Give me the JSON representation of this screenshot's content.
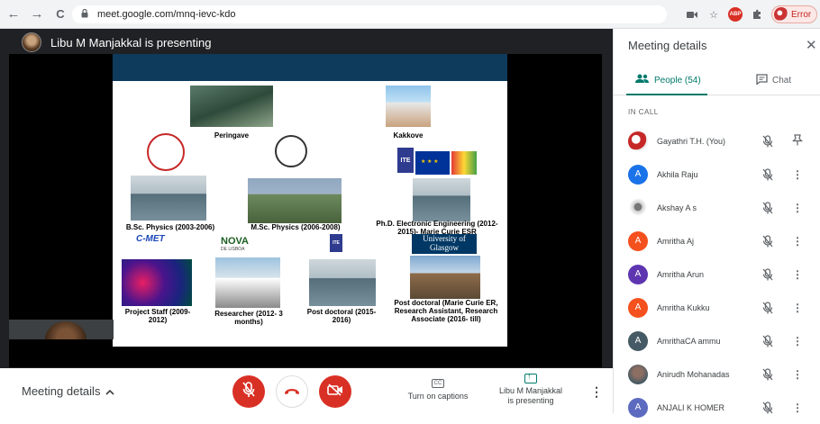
{
  "browser": {
    "back_icon": "←",
    "forward_icon": "→",
    "reload_icon": "C",
    "url": "meet.google.com/mnq-ievc-kdo",
    "profile_status": "Error"
  },
  "stage": {
    "presenter_text": "Libu M Manjakkal is presenting"
  },
  "slide": {
    "labels": {
      "peringave": "Peringave",
      "kakkove": "Kakkove",
      "bsc": "B.Sc. Physics (2003-2006)",
      "msc": "M.Sc. Physics (2006-2008)",
      "phd": "Ph.D. Electronic Engineering (2012-2015)- Marie Curie ESR",
      "project_staff": "Project Staff (2009-2012)",
      "researcher": "Researcher (2012- 3 months)",
      "postdoc1": "Post doctoral (2015- 2016)",
      "postdoc2": "Post doctoral  (Marie Curie ER, Research Assistant, Research Associate (2016- till)"
    },
    "logos": {
      "imet": "C-MET",
      "nova": "NOVA",
      "nova_sub": "DE LISBOA",
      "ite": "ITE",
      "glasgow": "University of Glasgow"
    }
  },
  "controls": {
    "meeting_details": "Meeting details",
    "captions": "Turn on captions",
    "cc_icon_text": "CC",
    "presenting_name": "Libu M Manjakkal",
    "presenting_status": "is presenting",
    "leave_icon": "phone-hangup-icon",
    "mic_icon": "mic-off-icon",
    "camera_icon": "camera-off-icon"
  },
  "panel": {
    "title": "Meeting details",
    "people_tab": "People (54)",
    "chat_tab": "Chat",
    "section_label": "IN CALL",
    "participants": [
      {
        "name": "Gayathri T.H. (You)",
        "initial": "",
        "color": "#ffffff",
        "action": "pin"
      },
      {
        "name": "Akhila Raju",
        "initial": "A",
        "color": "#1a73e8",
        "action": "more"
      },
      {
        "name": "Akshay A s",
        "initial": "",
        "color": "#ffffff",
        "action": "more"
      },
      {
        "name": "Amritha Aj",
        "initial": "A",
        "color": "#f4511e",
        "action": "more"
      },
      {
        "name": "Amritha Arun",
        "initial": "A",
        "color": "#5e35b1",
        "action": "more"
      },
      {
        "name": "Amritha Kukku",
        "initial": "A",
        "color": "#f4511e",
        "action": "more"
      },
      {
        "name": "AmrithaCA ammu",
        "initial": "A",
        "color": "#455a64",
        "action": "more"
      },
      {
        "name": "Anirudh Mohanadas",
        "initial": "",
        "color": "#607d8b",
        "action": "more"
      },
      {
        "name": "ANJALI K HOMER",
        "initial": "A",
        "color": "#5c6bc0",
        "action": "more"
      }
    ]
  }
}
